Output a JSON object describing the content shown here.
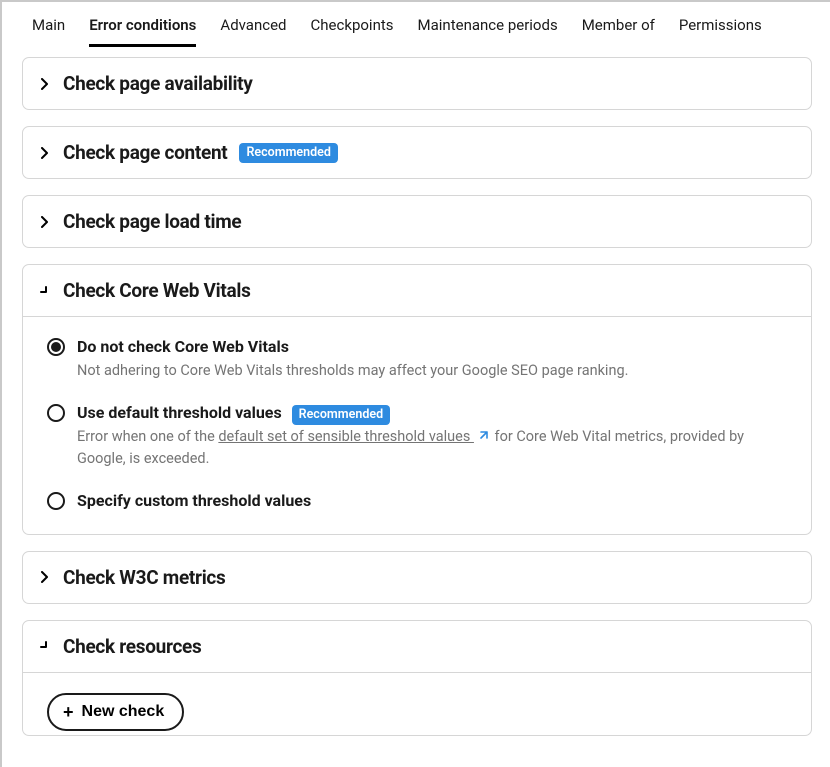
{
  "tabs": [
    {
      "label": "Main"
    },
    {
      "label": "Error conditions"
    },
    {
      "label": "Advanced"
    },
    {
      "label": "Checkpoints"
    },
    {
      "label": "Maintenance periods"
    },
    {
      "label": "Member of"
    },
    {
      "label": "Permissions"
    }
  ],
  "badge_text": "Recommended",
  "panels": {
    "availability": {
      "title": "Check page availability"
    },
    "content": {
      "title": "Check page content"
    },
    "loadtime": {
      "title": "Check page load time"
    },
    "cwv": {
      "title": "Check Core Web Vitals",
      "options": {
        "donot": {
          "label": "Do not check Core Web Vitals",
          "desc": "Not adhering to Core Web Vitals thresholds may affect your Google SEO page ranking."
        },
        "default": {
          "label": "Use default threshold values",
          "desc_pre": "Error when one of the ",
          "link": "default set of sensible threshold values ",
          "desc_post": " for Core Web Vital metrics, provided by Google, is exceeded."
        },
        "custom": {
          "label": "Specify custom threshold values"
        }
      }
    },
    "w3c": {
      "title": "Check W3C metrics"
    },
    "resources": {
      "title": "Check resources",
      "new_check": "New check"
    }
  }
}
